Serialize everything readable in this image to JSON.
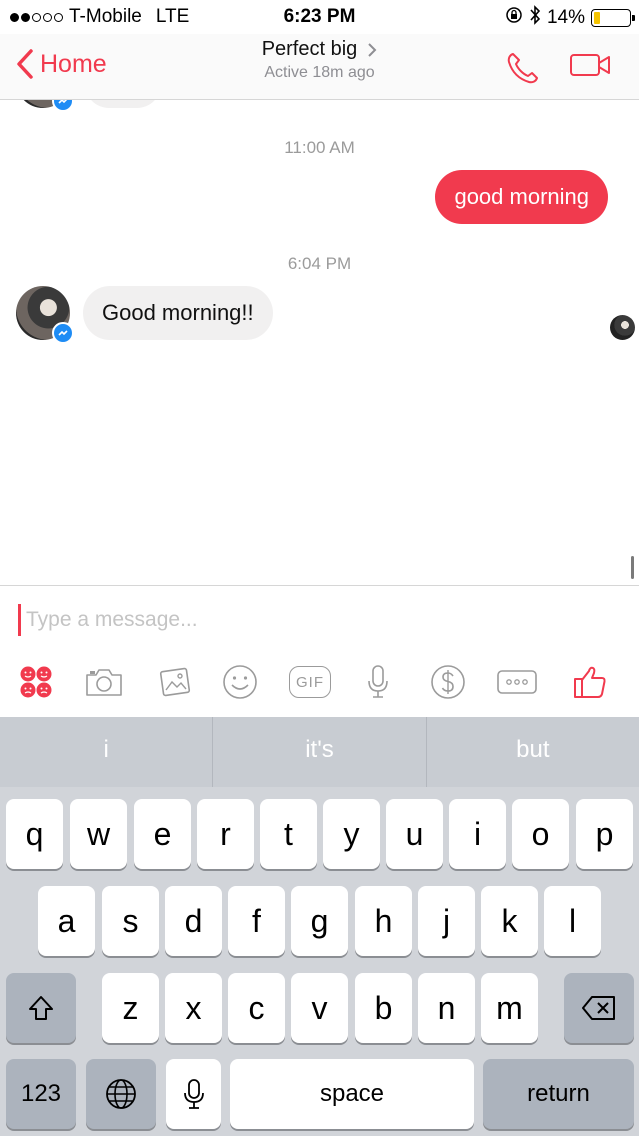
{
  "status_bar": {
    "carrier": "T-Mobile",
    "network": "LTE",
    "time": "6:23 PM",
    "battery": "14%"
  },
  "header": {
    "back_label": "Home",
    "contact_name": "Perfect big",
    "active_status": "Active 18m ago"
  },
  "conversation": {
    "timestamp_1": "11:00 AM",
    "outgoing_message": "good morning",
    "timestamp_2": "6:04 PM",
    "incoming_message": "Good morning!!"
  },
  "composer": {
    "placeholder": "Type a message...",
    "gif_label": "GIF"
  },
  "keyboard": {
    "suggestions": [
      "i",
      "it's",
      "but"
    ],
    "row1": [
      "q",
      "w",
      "e",
      "r",
      "t",
      "y",
      "u",
      "i",
      "o",
      "p"
    ],
    "row2": [
      "a",
      "s",
      "d",
      "f",
      "g",
      "h",
      "j",
      "k",
      "l"
    ],
    "row3": [
      "z",
      "x",
      "c",
      "v",
      "b",
      "n",
      "m"
    ],
    "numbers_label": "123",
    "space_label": "space",
    "return_label": "return"
  },
  "colors": {
    "accent": "#f13a4e",
    "incoming_bubble": "#f1f0f0",
    "keyboard_bg": "#d1d4d9",
    "messenger_blue": "#1e8cf5"
  }
}
